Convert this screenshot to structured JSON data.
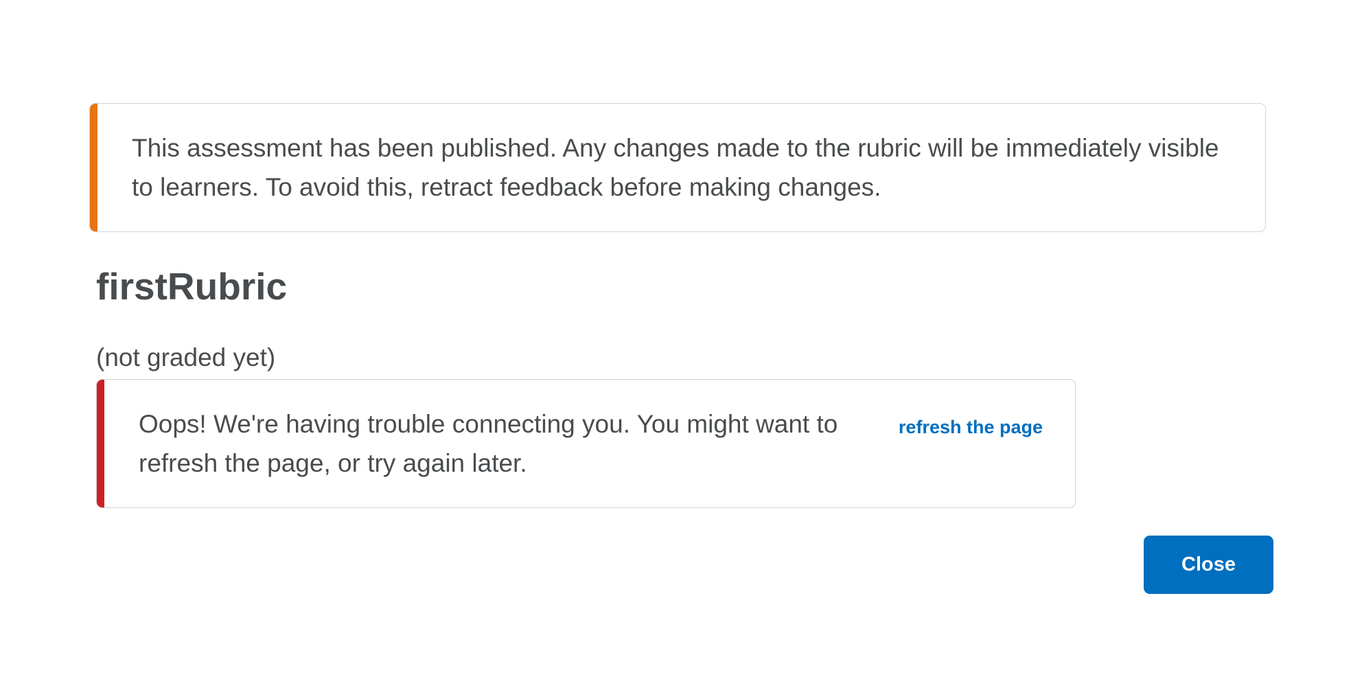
{
  "warning_alert": {
    "message": "This assessment has been published. Any changes made to the rubric will be immediately visible to learners. To avoid this, retract feedback before making changes."
  },
  "rubric": {
    "title": "firstRubric",
    "graded_status": "(not graded yet)"
  },
  "error_alert": {
    "message": "Oops! We're having trouble connecting you. You might want to refresh the page, or try again later.",
    "action_label": "refresh the page"
  },
  "footer": {
    "close_label": "Close"
  },
  "colors": {
    "warning_accent": "#e87511",
    "error_accent": "#cd2026",
    "primary": "#006fbf",
    "text": "#494c4e"
  }
}
